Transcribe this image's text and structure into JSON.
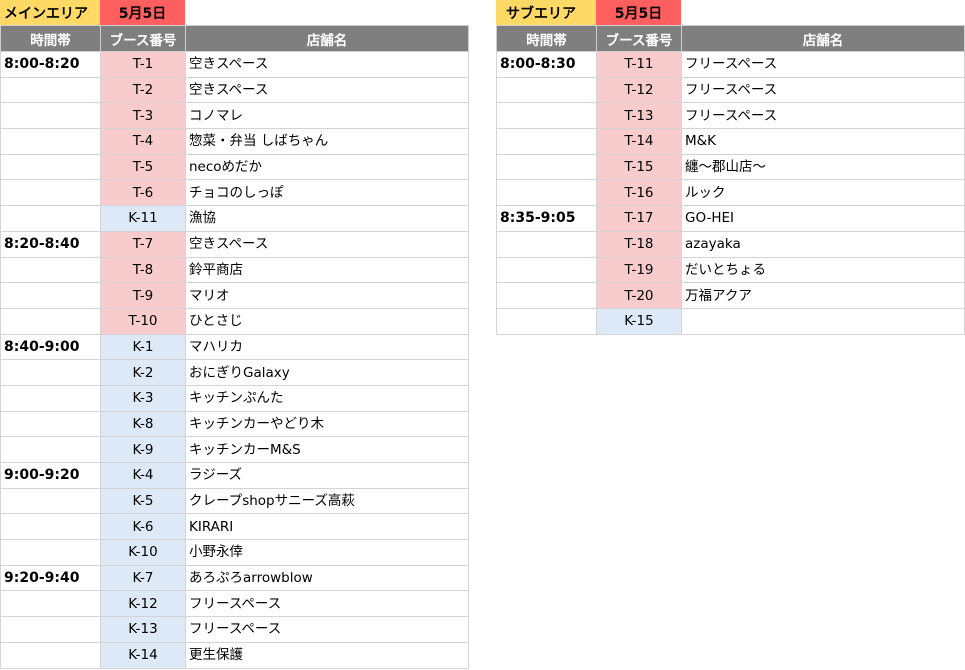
{
  "main": {
    "area_label": "メインエリア",
    "date_label": "5月5日",
    "headers": [
      "時間帯",
      "ブース番号",
      "店舗名"
    ],
    "rows": [
      {
        "time": "8:00-8:20",
        "booth": "T-1",
        "type": "t",
        "name": "空きスペース"
      },
      {
        "time": "",
        "booth": "T-2",
        "type": "t",
        "name": "空きスペース"
      },
      {
        "time": "",
        "booth": "T-3",
        "type": "t",
        "name": "コノマレ"
      },
      {
        "time": "",
        "booth": "T-4",
        "type": "t",
        "name": "惣菜・弁当 しばちゃん"
      },
      {
        "time": "",
        "booth": "T-5",
        "type": "t",
        "name": "necoめだか"
      },
      {
        "time": "",
        "booth": "T-6",
        "type": "t",
        "name": "チョコのしっぽ"
      },
      {
        "time": "",
        "booth": "K-11",
        "type": "k",
        "name": "漁協"
      },
      {
        "time": "8:20-8:40",
        "booth": "T-7",
        "type": "t",
        "name": "空きスペース"
      },
      {
        "time": "",
        "booth": "T-8",
        "type": "t",
        "name": "鈴平商店"
      },
      {
        "time": "",
        "booth": "T-9",
        "type": "t",
        "name": "マリオ"
      },
      {
        "time": "",
        "booth": "T-10",
        "type": "t",
        "name": "ひとさじ"
      },
      {
        "time": "8:40-9:00",
        "booth": "K-1",
        "type": "k",
        "name": "マハリカ"
      },
      {
        "time": "",
        "booth": "K-2",
        "type": "k",
        "name": "おにぎりGalaxy"
      },
      {
        "time": "",
        "booth": "K-3",
        "type": "k",
        "name": "キッチンぷんた"
      },
      {
        "time": "",
        "booth": "K-8",
        "type": "k",
        "name": "キッチンカーやどり木"
      },
      {
        "time": "",
        "booth": "K-9",
        "type": "k",
        "name": "キッチンカーM&S"
      },
      {
        "time": "9:00-9:20",
        "booth": "K-4",
        "type": "k",
        "name": "ラジーズ"
      },
      {
        "time": "",
        "booth": "K-5",
        "type": "k",
        "name": "クレープshopサニーズ高萩"
      },
      {
        "time": "",
        "booth": "K-6",
        "type": "k",
        "name": "KIRARI"
      },
      {
        "time": "",
        "booth": "K-10",
        "type": "k",
        "name": "小野永倖"
      },
      {
        "time": "9:20-9:40",
        "booth": "K-7",
        "type": "k",
        "name": "あろぷろarrowblow"
      },
      {
        "time": "",
        "booth": "K-12",
        "type": "k",
        "name": "フリースペース"
      },
      {
        "time": "",
        "booth": "K-13",
        "type": "k",
        "name": "フリースペース"
      },
      {
        "time": "",
        "booth": "K-14",
        "type": "k",
        "name": "更生保護"
      }
    ]
  },
  "sub": {
    "area_label": "サブエリア",
    "date_label": "5月5日",
    "headers": [
      "時間帯",
      "ブース番号",
      "店舗名"
    ],
    "rows": [
      {
        "time": "8:00-8:30",
        "booth": "T-11",
        "type": "t",
        "name": "フリースペース"
      },
      {
        "time": "",
        "booth": "T-12",
        "type": "t",
        "name": "フリースペース"
      },
      {
        "time": "",
        "booth": "T-13",
        "type": "t",
        "name": "フリースペース"
      },
      {
        "time": "",
        "booth": "T-14",
        "type": "t",
        "name": "M&K"
      },
      {
        "time": "",
        "booth": "T-15",
        "type": "t",
        "name": "纏〜郡山店〜"
      },
      {
        "time": "",
        "booth": "T-16",
        "type": "t",
        "name": "ルック"
      },
      {
        "time": "8:35-9:05",
        "booth": "T-17",
        "type": "t",
        "name": "GO-HEI"
      },
      {
        "time": "",
        "booth": "T-18",
        "type": "t",
        "name": "azayaka"
      },
      {
        "time": "",
        "booth": "T-19",
        "type": "t",
        "name": "だいとちょる"
      },
      {
        "time": "",
        "booth": "T-20",
        "type": "t",
        "name": "万福アクア"
      },
      {
        "time": "",
        "booth": "K-15",
        "type": "k",
        "name": ""
      }
    ]
  }
}
